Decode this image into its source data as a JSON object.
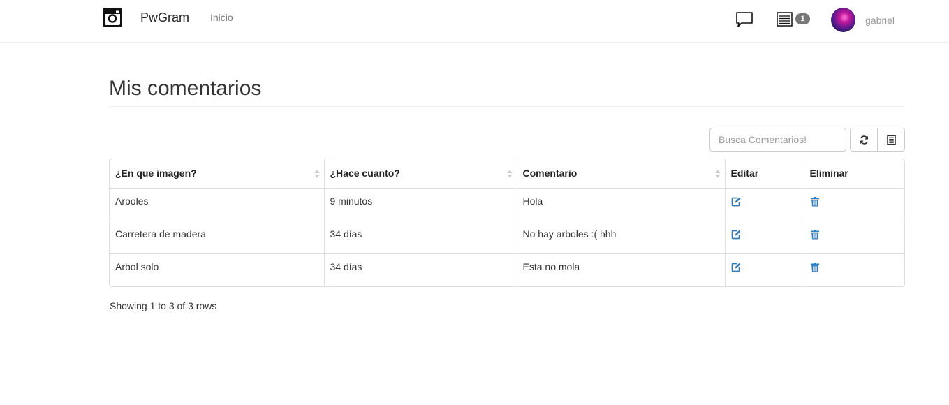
{
  "navbar": {
    "brand": "PwGram",
    "links": [
      {
        "label": "Inicio"
      }
    ],
    "notifications_badge": "1",
    "username": "gabriel",
    "icons": {
      "logo": "instagram-camera-icon",
      "messages": "chat-bubble-icon",
      "notifications": "list-icon",
      "profile": "avatar"
    }
  },
  "page": {
    "title": "Mis comentarios"
  },
  "toolbar": {
    "search_placeholder": "Busca Comentarios!",
    "refresh_icon": "refresh-icon",
    "columns_icon": "columns-icon"
  },
  "table": {
    "headers": [
      "¿En que imagen?",
      "¿Hace cuanto?",
      "Comentario",
      "Editar",
      "Eliminar"
    ],
    "rows": [
      {
        "imagen": "Arboles",
        "hace": "9 minutos",
        "comentario": "Hola"
      },
      {
        "imagen": "Carretera de madera",
        "hace": "34 días",
        "comentario": "No hay arboles :( hhh"
      },
      {
        "imagen": "Arbol solo",
        "hace": "34 días",
        "comentario": "Esta no mola"
      }
    ],
    "edit_icon": "edit-icon",
    "delete_icon": "trash-icon",
    "accent_color": "#337ab7"
  },
  "pagination": {
    "info": "Showing 1 to 3 of 3 rows"
  }
}
